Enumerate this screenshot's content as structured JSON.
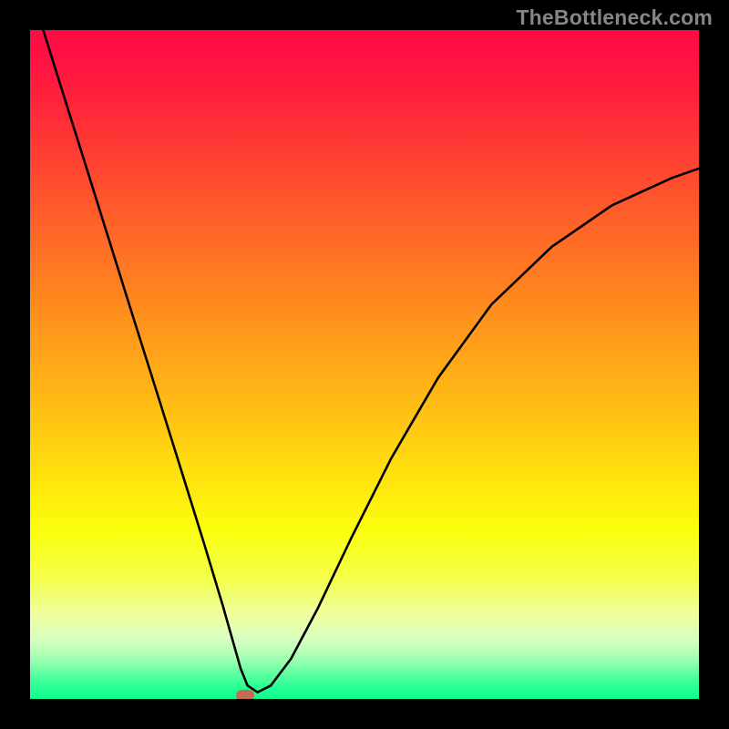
{
  "watermark": "TheBottleneck.com",
  "chart_data": {
    "type": "line",
    "title": "",
    "xlabel": "",
    "ylabel": "",
    "xlim": [
      0,
      1
    ],
    "ylim": [
      0,
      1
    ],
    "curve": {
      "x": [
        0.015,
        0.05,
        0.085,
        0.12,
        0.155,
        0.19,
        0.225,
        0.26,
        0.288,
        0.305,
        0.315,
        0.325,
        0.34,
        0.36,
        0.39,
        0.43,
        0.48,
        0.54,
        0.61,
        0.69,
        0.78,
        0.87,
        0.96,
        1.0
      ],
      "y": [
        1.015,
        0.903,
        0.792,
        0.68,
        0.568,
        0.457,
        0.345,
        0.233,
        0.14,
        0.08,
        0.045,
        0.02,
        0.01,
        0.02,
        0.06,
        0.135,
        0.24,
        0.36,
        0.48,
        0.59,
        0.676,
        0.738,
        0.779,
        0.793
      ]
    },
    "marker": {
      "x": 0.322,
      "y": 0.006,
      "color": "#c96a55"
    },
    "gradient_stops": [
      {
        "pos": 0.0,
        "color": "#ff0a46"
      },
      {
        "pos": 0.5,
        "color": "#ffc313"
      },
      {
        "pos": 0.8,
        "color": "#f4ff4b"
      },
      {
        "pos": 1.0,
        "color": "#0dff8e"
      }
    ]
  }
}
